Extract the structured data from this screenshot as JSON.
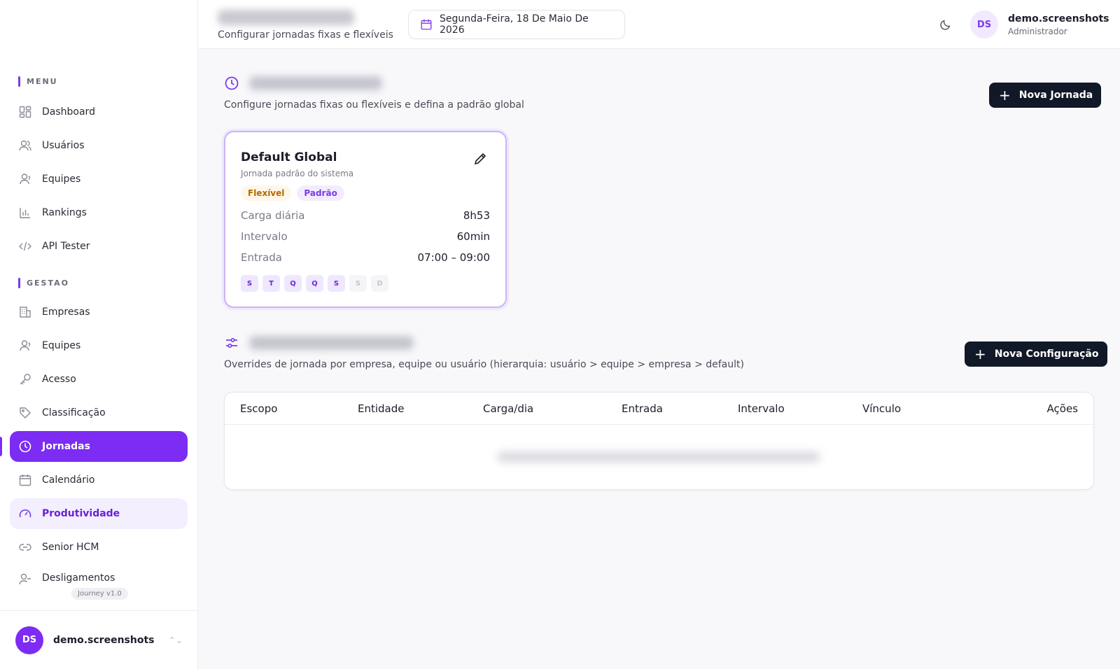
{
  "sidebar": {
    "sections": [
      {
        "label": "MENU"
      },
      {
        "label": "GESTAO"
      }
    ],
    "menu_items": [
      {
        "label": "Dashboard",
        "icon": "dashboard-icon"
      },
      {
        "label": "Usuários",
        "icon": "users-icon"
      },
      {
        "label": "Equipes",
        "icon": "team-icon"
      },
      {
        "label": "Rankings",
        "icon": "bar-chart-icon"
      },
      {
        "label": "API Tester",
        "icon": "code-icon"
      }
    ],
    "gestao_items": [
      {
        "label": "Empresas",
        "icon": "building-icon"
      },
      {
        "label": "Equipes",
        "icon": "team-icon"
      },
      {
        "label": "Acesso",
        "icon": "key-icon"
      },
      {
        "label": "Classificação",
        "icon": "tag-icon"
      },
      {
        "label": "Jornadas",
        "icon": "clock-icon"
      },
      {
        "label": "Calendário",
        "icon": "calendar-icon"
      },
      {
        "label": "Produtividade",
        "icon": "gauge-icon"
      },
      {
        "label": "Senior HCM",
        "icon": "link-icon"
      },
      {
        "label": "Desligamentos",
        "icon": "user-minus-icon"
      }
    ],
    "version": "Journey v1.0",
    "footer_user": {
      "initials": "DS",
      "name": "demo.screenshots"
    }
  },
  "topbar": {
    "subtitle": "Configurar jornadas fixas e flexíveis",
    "date": "Segunda-Feira, 18 De Maio De 2026",
    "user": {
      "initials": "DS",
      "name": "demo.screenshots",
      "role": "Administrador"
    }
  },
  "jornadas": {
    "description": "Configure jornadas fixas ou flexíveis e defina a padrão global",
    "new_button": "Nova Jornada"
  },
  "card": {
    "title": "Default Global",
    "subtitle": "Jornada padrão do sistema",
    "badges": [
      "Flexível",
      "Padrão"
    ],
    "rows": [
      {
        "label": "Carga diária",
        "value": "8h53"
      },
      {
        "label": "Intervalo",
        "value": "60min"
      },
      {
        "label": "Entrada",
        "value": "07:00 – 09:00"
      }
    ],
    "days": [
      {
        "letter": "S",
        "active": true
      },
      {
        "letter": "T",
        "active": true
      },
      {
        "letter": "Q",
        "active": true
      },
      {
        "letter": "Q",
        "active": true
      },
      {
        "letter": "S",
        "active": true
      },
      {
        "letter": "S",
        "active": false
      },
      {
        "letter": "D",
        "active": false
      }
    ]
  },
  "config": {
    "description": "Overrides de jornada por empresa, equipe ou usuário (hierarquia: usuário > equipe > empresa > default)",
    "new_button": "Nova Configuração",
    "columns": [
      "Escopo",
      "Entidade",
      "Carga/dia",
      "Entrada",
      "Intervalo",
      "Vínculo",
      "Ações"
    ]
  },
  "colors": {
    "accent": "#7c2cf3",
    "dark_button": "#111827"
  }
}
